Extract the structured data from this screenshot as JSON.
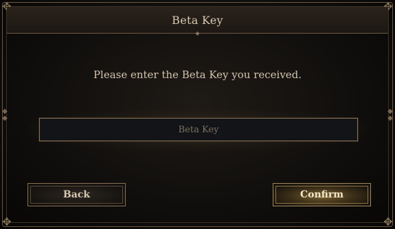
{
  "dialog": {
    "title": "Beta Key",
    "prompt": "Please enter the Beta Key you received.",
    "input": {
      "value": "",
      "placeholder": "Beta Key"
    },
    "buttons": {
      "back_label": "Back",
      "confirm_label": "Confirm"
    }
  },
  "colors": {
    "accent_border": "#8a7254",
    "text": "#d2c4ae",
    "confirm_glow": "#7a6232"
  }
}
